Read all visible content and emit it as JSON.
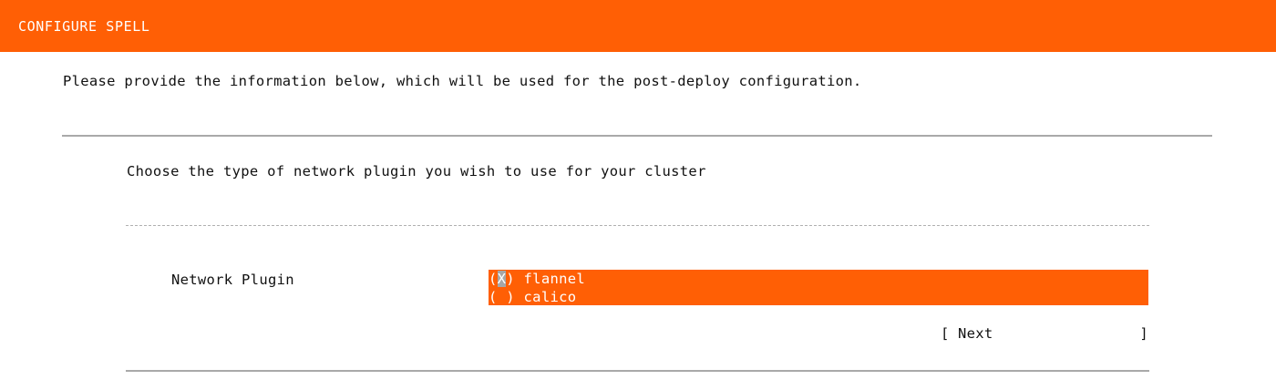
{
  "header": {
    "title": "CONFIGURE SPELL"
  },
  "instructions": "Please provide the information below, which will be used for the post-deploy configuration.",
  "question": "Choose the type of network plugin you wish to use for your cluster",
  "form": {
    "field_label": "Network Plugin",
    "options": [
      {
        "marker_open": "(",
        "marker_value": "X",
        "marker_close": ")",
        "label": " flannel",
        "selected": true
      },
      {
        "marker_open": "(",
        "marker_value": " ",
        "marker_close": ")",
        "label": " calico",
        "selected": false
      }
    ]
  },
  "next_button": {
    "bracket_left": "[",
    "label": "Next",
    "bracket_right": "]"
  },
  "colors": {
    "accent": "#ff5f05",
    "cursor": "#a6a6a6",
    "divider": "#a9a9a9"
  }
}
